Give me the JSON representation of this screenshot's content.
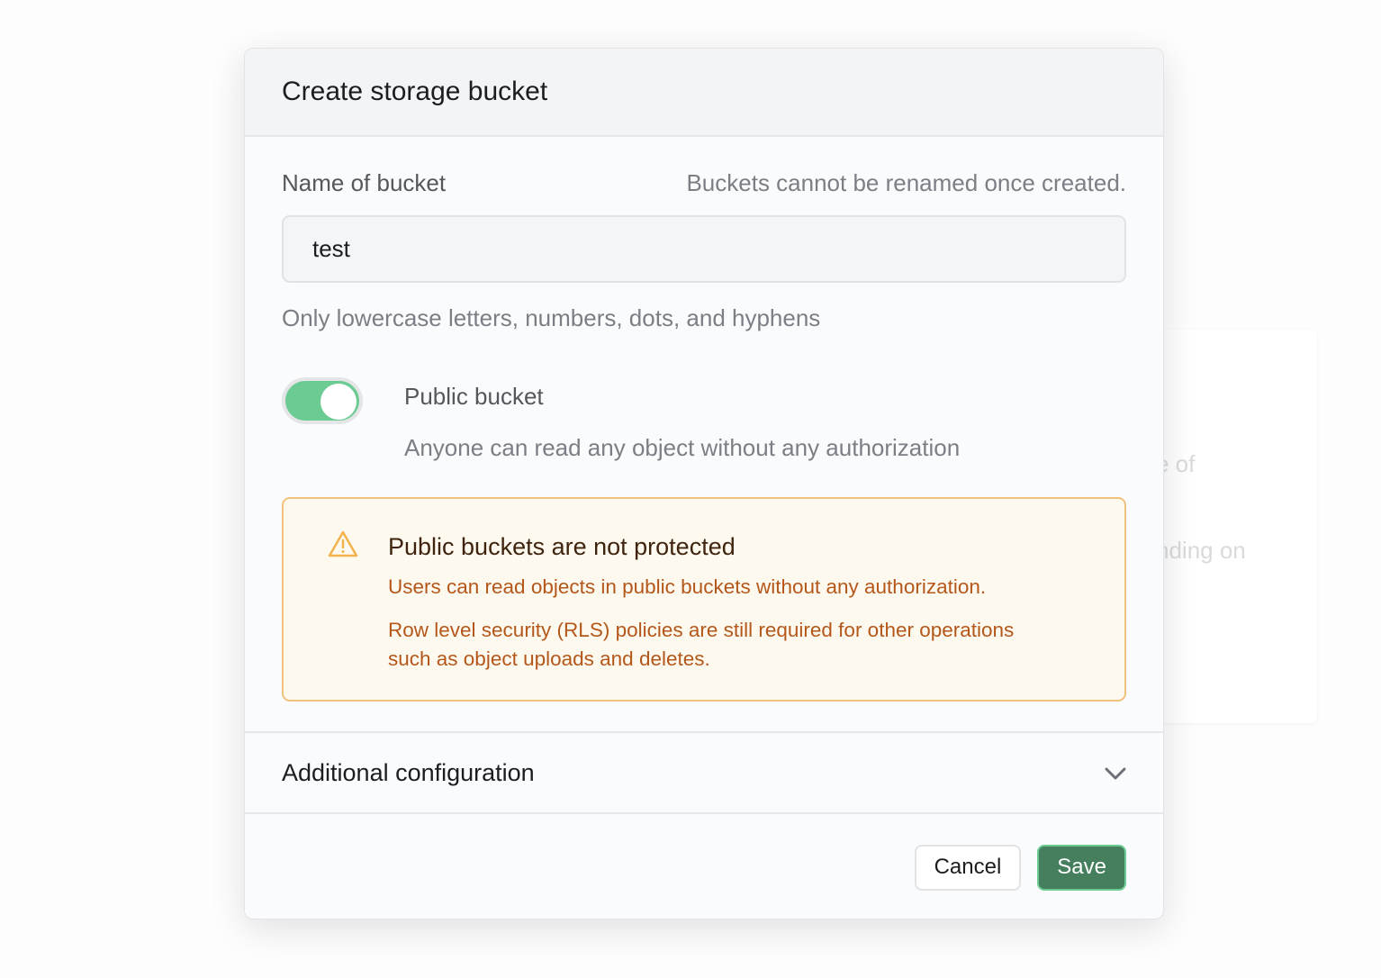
{
  "background": {
    "fragments": [
      "e of",
      "nding on"
    ]
  },
  "modal": {
    "title": "Create storage bucket",
    "name_field": {
      "label": "Name of bucket",
      "hint": "Buckets cannot be renamed once created.",
      "value": "test",
      "help": "Only lowercase letters, numbers, dots, and hyphens"
    },
    "public_toggle": {
      "label": "Public bucket",
      "description": "Anyone can read any object without any authorization",
      "checked": true,
      "color": "#6ccb92"
    },
    "alert": {
      "icon": "warning-triangle-icon",
      "title": "Public buckets are not protected",
      "line1": "Users can read objects in public buckets without any authorization.",
      "line2": "Row level security (RLS) policies are still required for other operations",
      "line3": "such as object uploads and deletes."
    },
    "additional": {
      "label": "Additional configuration",
      "icon": "chevron-down-icon"
    },
    "footer": {
      "cancel_label": "Cancel",
      "save_label": "Save",
      "save_color": "#457f5d"
    }
  }
}
